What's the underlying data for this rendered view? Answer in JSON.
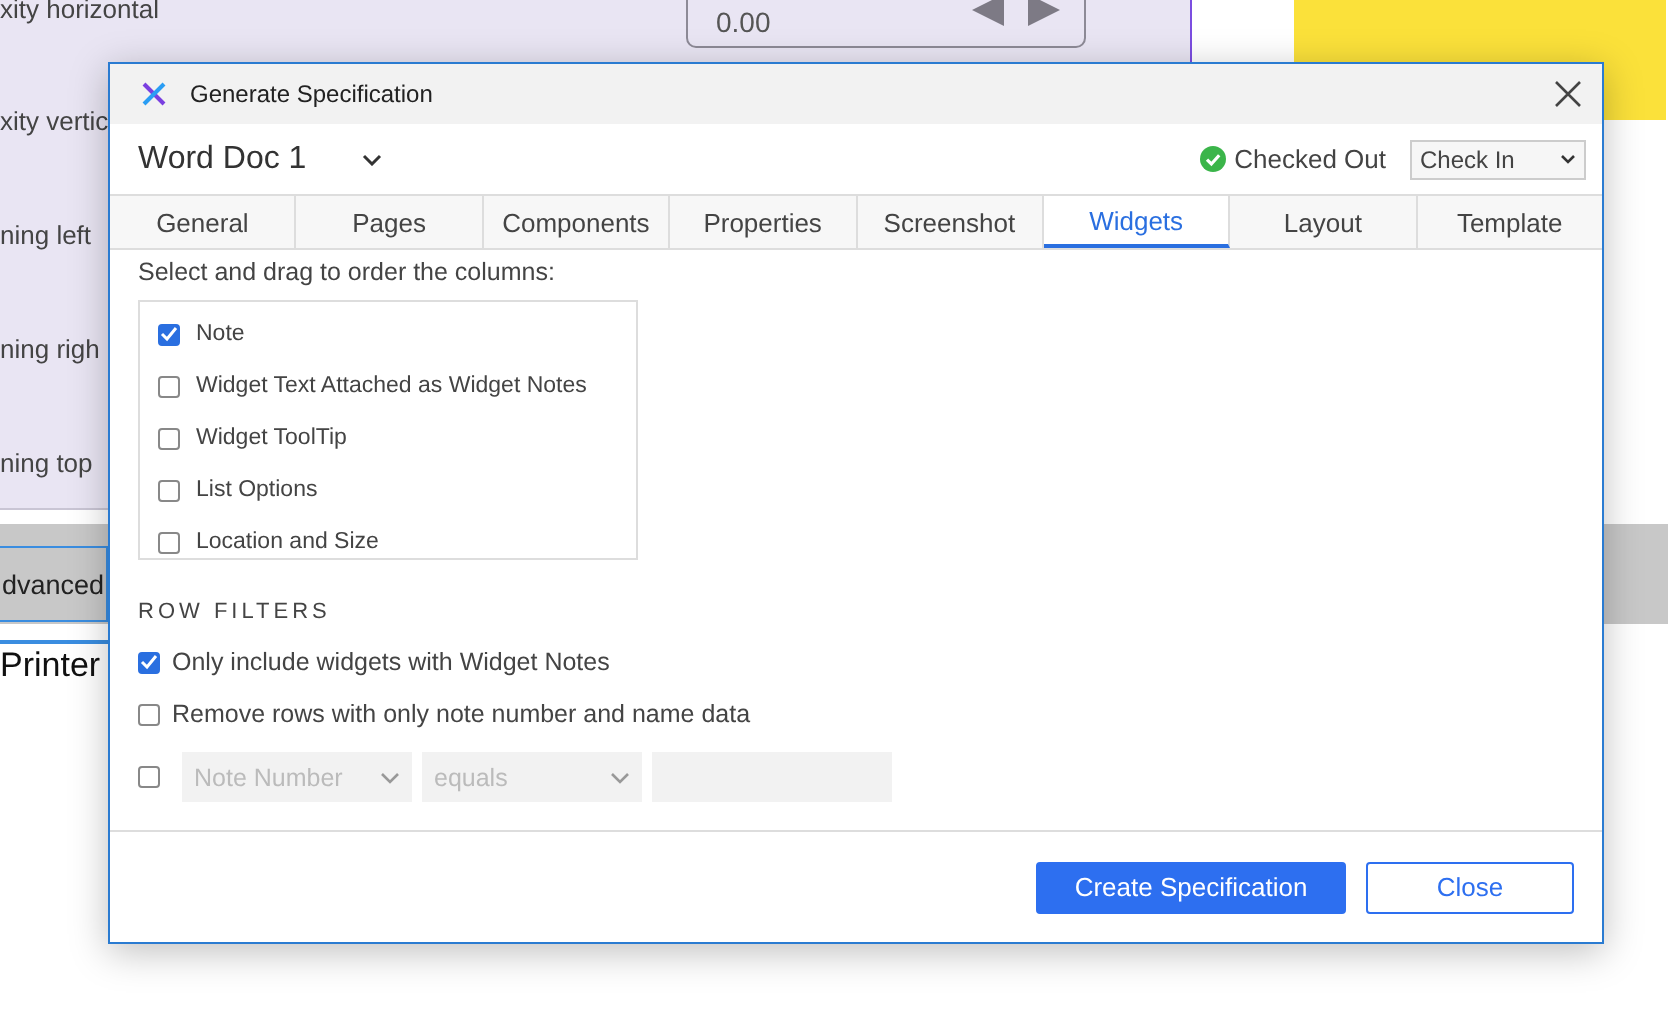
{
  "background": {
    "panel_labels": [
      "xity horizontal",
      "xity vertic",
      "ning left",
      "ning righ",
      "ning top"
    ],
    "spin_value": "0.00",
    "advanced_button": "dvanced",
    "printer_label": "Printer"
  },
  "dialog": {
    "title": "Generate Specification",
    "document": "Word Doc 1",
    "status": "Checked Out",
    "check_select": "Check In",
    "tabs": [
      {
        "label": "General",
        "selected": false
      },
      {
        "label": "Pages",
        "selected": false
      },
      {
        "label": "Components",
        "selected": false
      },
      {
        "label": "Properties",
        "selected": false
      },
      {
        "label": "Screenshot",
        "selected": false
      },
      {
        "label": "Widgets",
        "selected": true
      },
      {
        "label": "Layout",
        "selected": false
      },
      {
        "label": "Template",
        "selected": false
      }
    ],
    "instruction": "Select and drag to order the columns:",
    "columns": [
      {
        "label": "Note",
        "checked": true
      },
      {
        "label": "Widget Text Attached as Widget Notes",
        "checked": false
      },
      {
        "label": "Widget ToolTip",
        "checked": false
      },
      {
        "label": "List Options",
        "checked": false
      },
      {
        "label": "Location and Size",
        "checked": false
      }
    ],
    "row_filters": {
      "heading": "ROW FILTERS",
      "options": [
        {
          "label": "Only include widgets with Widget Notes",
          "checked": true
        },
        {
          "label": "Remove rows with only note number and name data",
          "checked": false
        }
      ],
      "custom_filter": {
        "checked": false,
        "disabled": true,
        "field": "Note Number",
        "operator": "equals"
      }
    },
    "buttons": [
      {
        "label": "Create Specification",
        "kind": "primary"
      },
      {
        "label": "Close",
        "kind": "secondary"
      }
    ]
  }
}
